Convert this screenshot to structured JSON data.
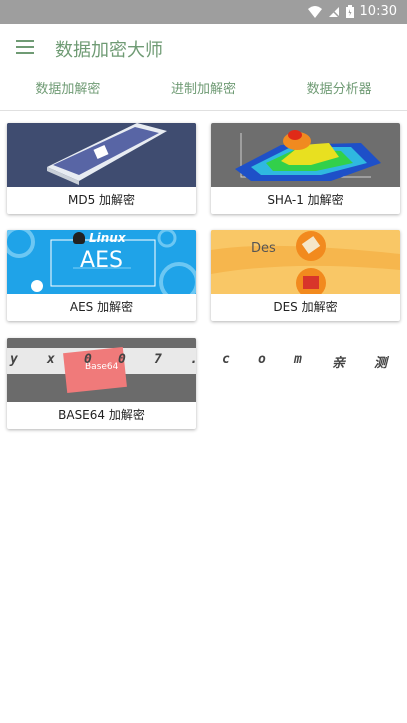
{
  "status_bar": {
    "time": "10:30"
  },
  "app_bar": {
    "title": "数据加密大师"
  },
  "tabs": [
    {
      "label": "数据加解密"
    },
    {
      "label": "进制加解密"
    },
    {
      "label": "数据分析器"
    }
  ],
  "cards": [
    {
      "label": "MD5 加解密"
    },
    {
      "label": "SHA-1 加解密"
    },
    {
      "label": "AES 加解密",
      "thumb_heading": "Linux",
      "thumb_title": "AES"
    },
    {
      "label": "DES 加解密",
      "thumb_heading": "Des"
    },
    {
      "label": "BASE64 加解密",
      "thumb_caption": "Base64"
    }
  ],
  "watermark": [
    "y",
    "x",
    "0",
    "0",
    "7",
    ".",
    "c",
    "o",
    "m",
    "亲",
    "测"
  ]
}
